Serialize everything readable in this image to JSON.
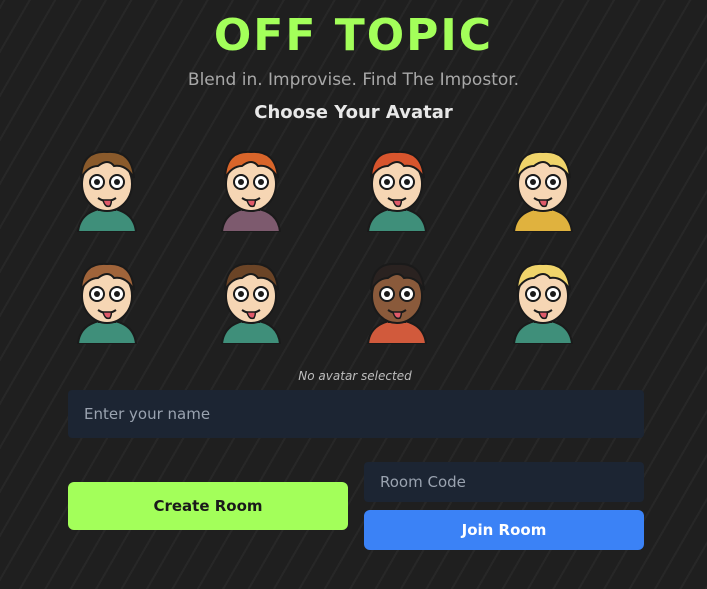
{
  "header": {
    "title": "OFF TOPIC",
    "subtitle": "Blend in. Improvise. Find The Impostor."
  },
  "avatars": {
    "heading": "Choose Your Avatar",
    "selection_status": "No avatar selected",
    "items": [
      {
        "name": "avatar-winking-tongue",
        "hair": "#8a5a2b",
        "shirt": "#3f8f7a"
      },
      {
        "name": "avatar-surprised-redhead",
        "hair": "#d9652a",
        "shirt": "#7d5a6e"
      },
      {
        "name": "avatar-peace-sign-redhair",
        "hair": "#d8552d",
        "shirt": "#3f8f7a"
      },
      {
        "name": "avatar-teal-cap-tongue",
        "hair": "#f0d46a",
        "shirt": "#e0b23e"
      },
      {
        "name": "avatar-brown-hair-tongue",
        "hair": "#a0643a",
        "shirt": "#3f8f7a"
      },
      {
        "name": "avatar-suspicious-brunette",
        "hair": "#6b4426",
        "shirt": "#3f8f7a"
      },
      {
        "name": "avatar-curly-thinking",
        "hair": "#2a2220",
        "shirt": "#d15a3c"
      },
      {
        "name": "avatar-glasses-blonde",
        "hair": "#f0d46a",
        "shirt": "#3f8f7a"
      }
    ]
  },
  "form": {
    "name_placeholder": "Enter your name",
    "room_code_placeholder": "Room Code",
    "create_label": "Create Room",
    "join_label": "Join Room"
  },
  "colors": {
    "accent_green": "#a3ff5a",
    "accent_blue": "#3b82f6",
    "input_bg": "#1c2533",
    "background": "#1f1f1f"
  }
}
